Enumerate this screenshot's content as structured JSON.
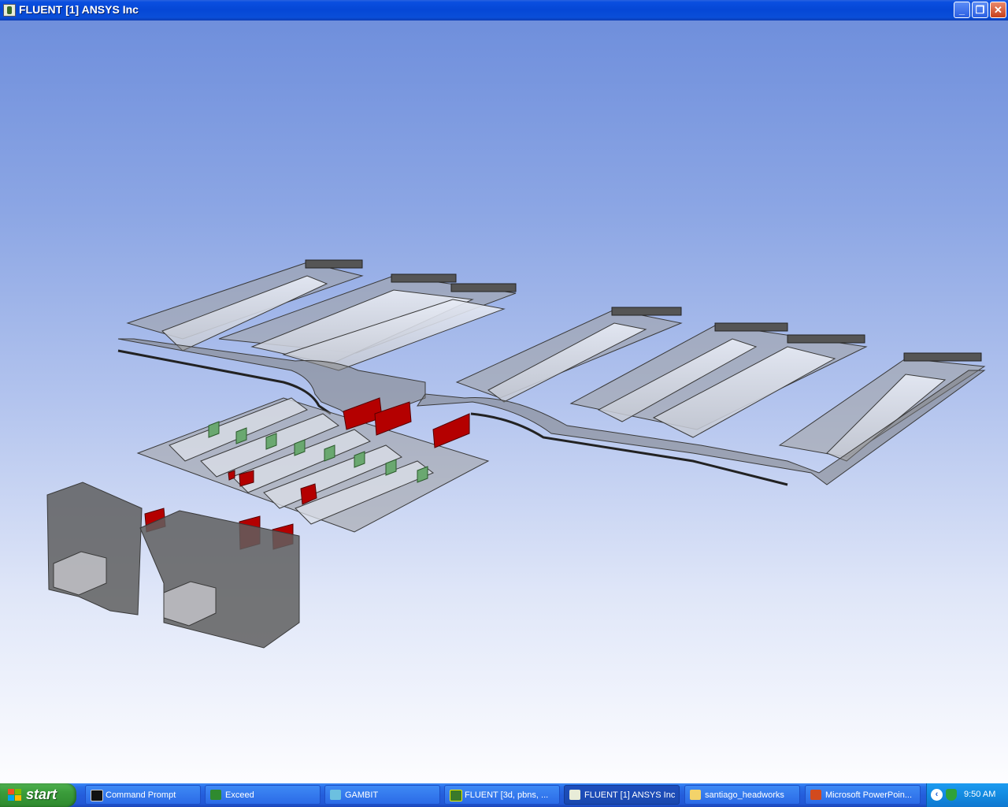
{
  "window": {
    "title": "FLUENT [1] ANSYS Inc",
    "minimize_glyph": "_",
    "maximize_glyph": "❐",
    "close_glyph": "✕"
  },
  "viewport": {
    "scene": "3d-geometry-wireframe",
    "background_top": "#6f8fdc",
    "background_bottom": "#ffffff",
    "accent_red": "#c00000",
    "accent_green": "#6aa870",
    "body_gray": "#6c6c6c"
  },
  "taskbar": {
    "start_label": "start",
    "tasks": [
      {
        "label": "Command Prompt",
        "icon": "cmd-icon",
        "active": false
      },
      {
        "label": "Exceed",
        "icon": "exceed-icon",
        "active": false
      },
      {
        "label": "GAMBIT",
        "icon": "gambit-icon",
        "active": false
      },
      {
        "label": "FLUENT  [3d, pbns, ...",
        "icon": "fluent-icon",
        "active": false
      },
      {
        "label": "FLUENT [1] ANSYS Inc",
        "icon": "fluent-icon",
        "active": true
      },
      {
        "label": "santiago_headworks",
        "icon": "folder-icon",
        "active": false
      },
      {
        "label": "Microsoft PowerPoin...",
        "icon": "powerpoint-icon",
        "active": false
      }
    ],
    "clock": "9:50 AM"
  }
}
